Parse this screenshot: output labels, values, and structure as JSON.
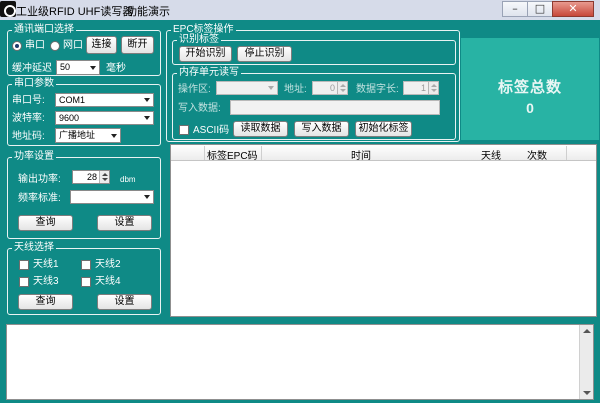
{
  "window": {
    "title": "工业级RFID UHF读写器",
    "menu": "功能演示"
  },
  "comm": {
    "legend": "通讯端口选择",
    "serial_label": "串口",
    "net_label": "网口",
    "connect": "连接",
    "disconnect": "断开",
    "delay_label": "缓冲延迟",
    "delay_value": "50",
    "delay_unit": "毫秒"
  },
  "serial_params": {
    "legend": "串口参数",
    "port_label": "串口号:",
    "port_value": "COM1",
    "baud_label": "波特率:",
    "baud_value": "9600",
    "addr_label": "地址码:",
    "addr_value": "广播地址"
  },
  "power": {
    "legend": "功率设置",
    "output_label": "输出功率:",
    "output_value": "28",
    "unit": "dbm",
    "freq_label": "频率标准:",
    "query": "查询",
    "set": "设置"
  },
  "antenna": {
    "legend": "天线选择",
    "items": [
      "天线1",
      "天线2",
      "天线3",
      "天线4"
    ],
    "query": "查询",
    "set": "设置"
  },
  "epc": {
    "legend": "EPC标签操作",
    "identify_legend": "识别标签",
    "start": "开始识别",
    "stop": "停止识别",
    "memory_legend": "内存单元读写",
    "area_label": "操作区:",
    "addr_label": "地址:",
    "addr_value": "0",
    "len_label": "数据字长:",
    "len_value": "1",
    "write_label": "写入数据:",
    "ascii_label": "ASCII码",
    "read": "读取数据",
    "write": "写入数据",
    "init": "初始化标签"
  },
  "total": {
    "title": "标签总数",
    "value": "0"
  },
  "table": {
    "columns": [
      "标签EPC码",
      "时间",
      "天线",
      "次数"
    ]
  }
}
